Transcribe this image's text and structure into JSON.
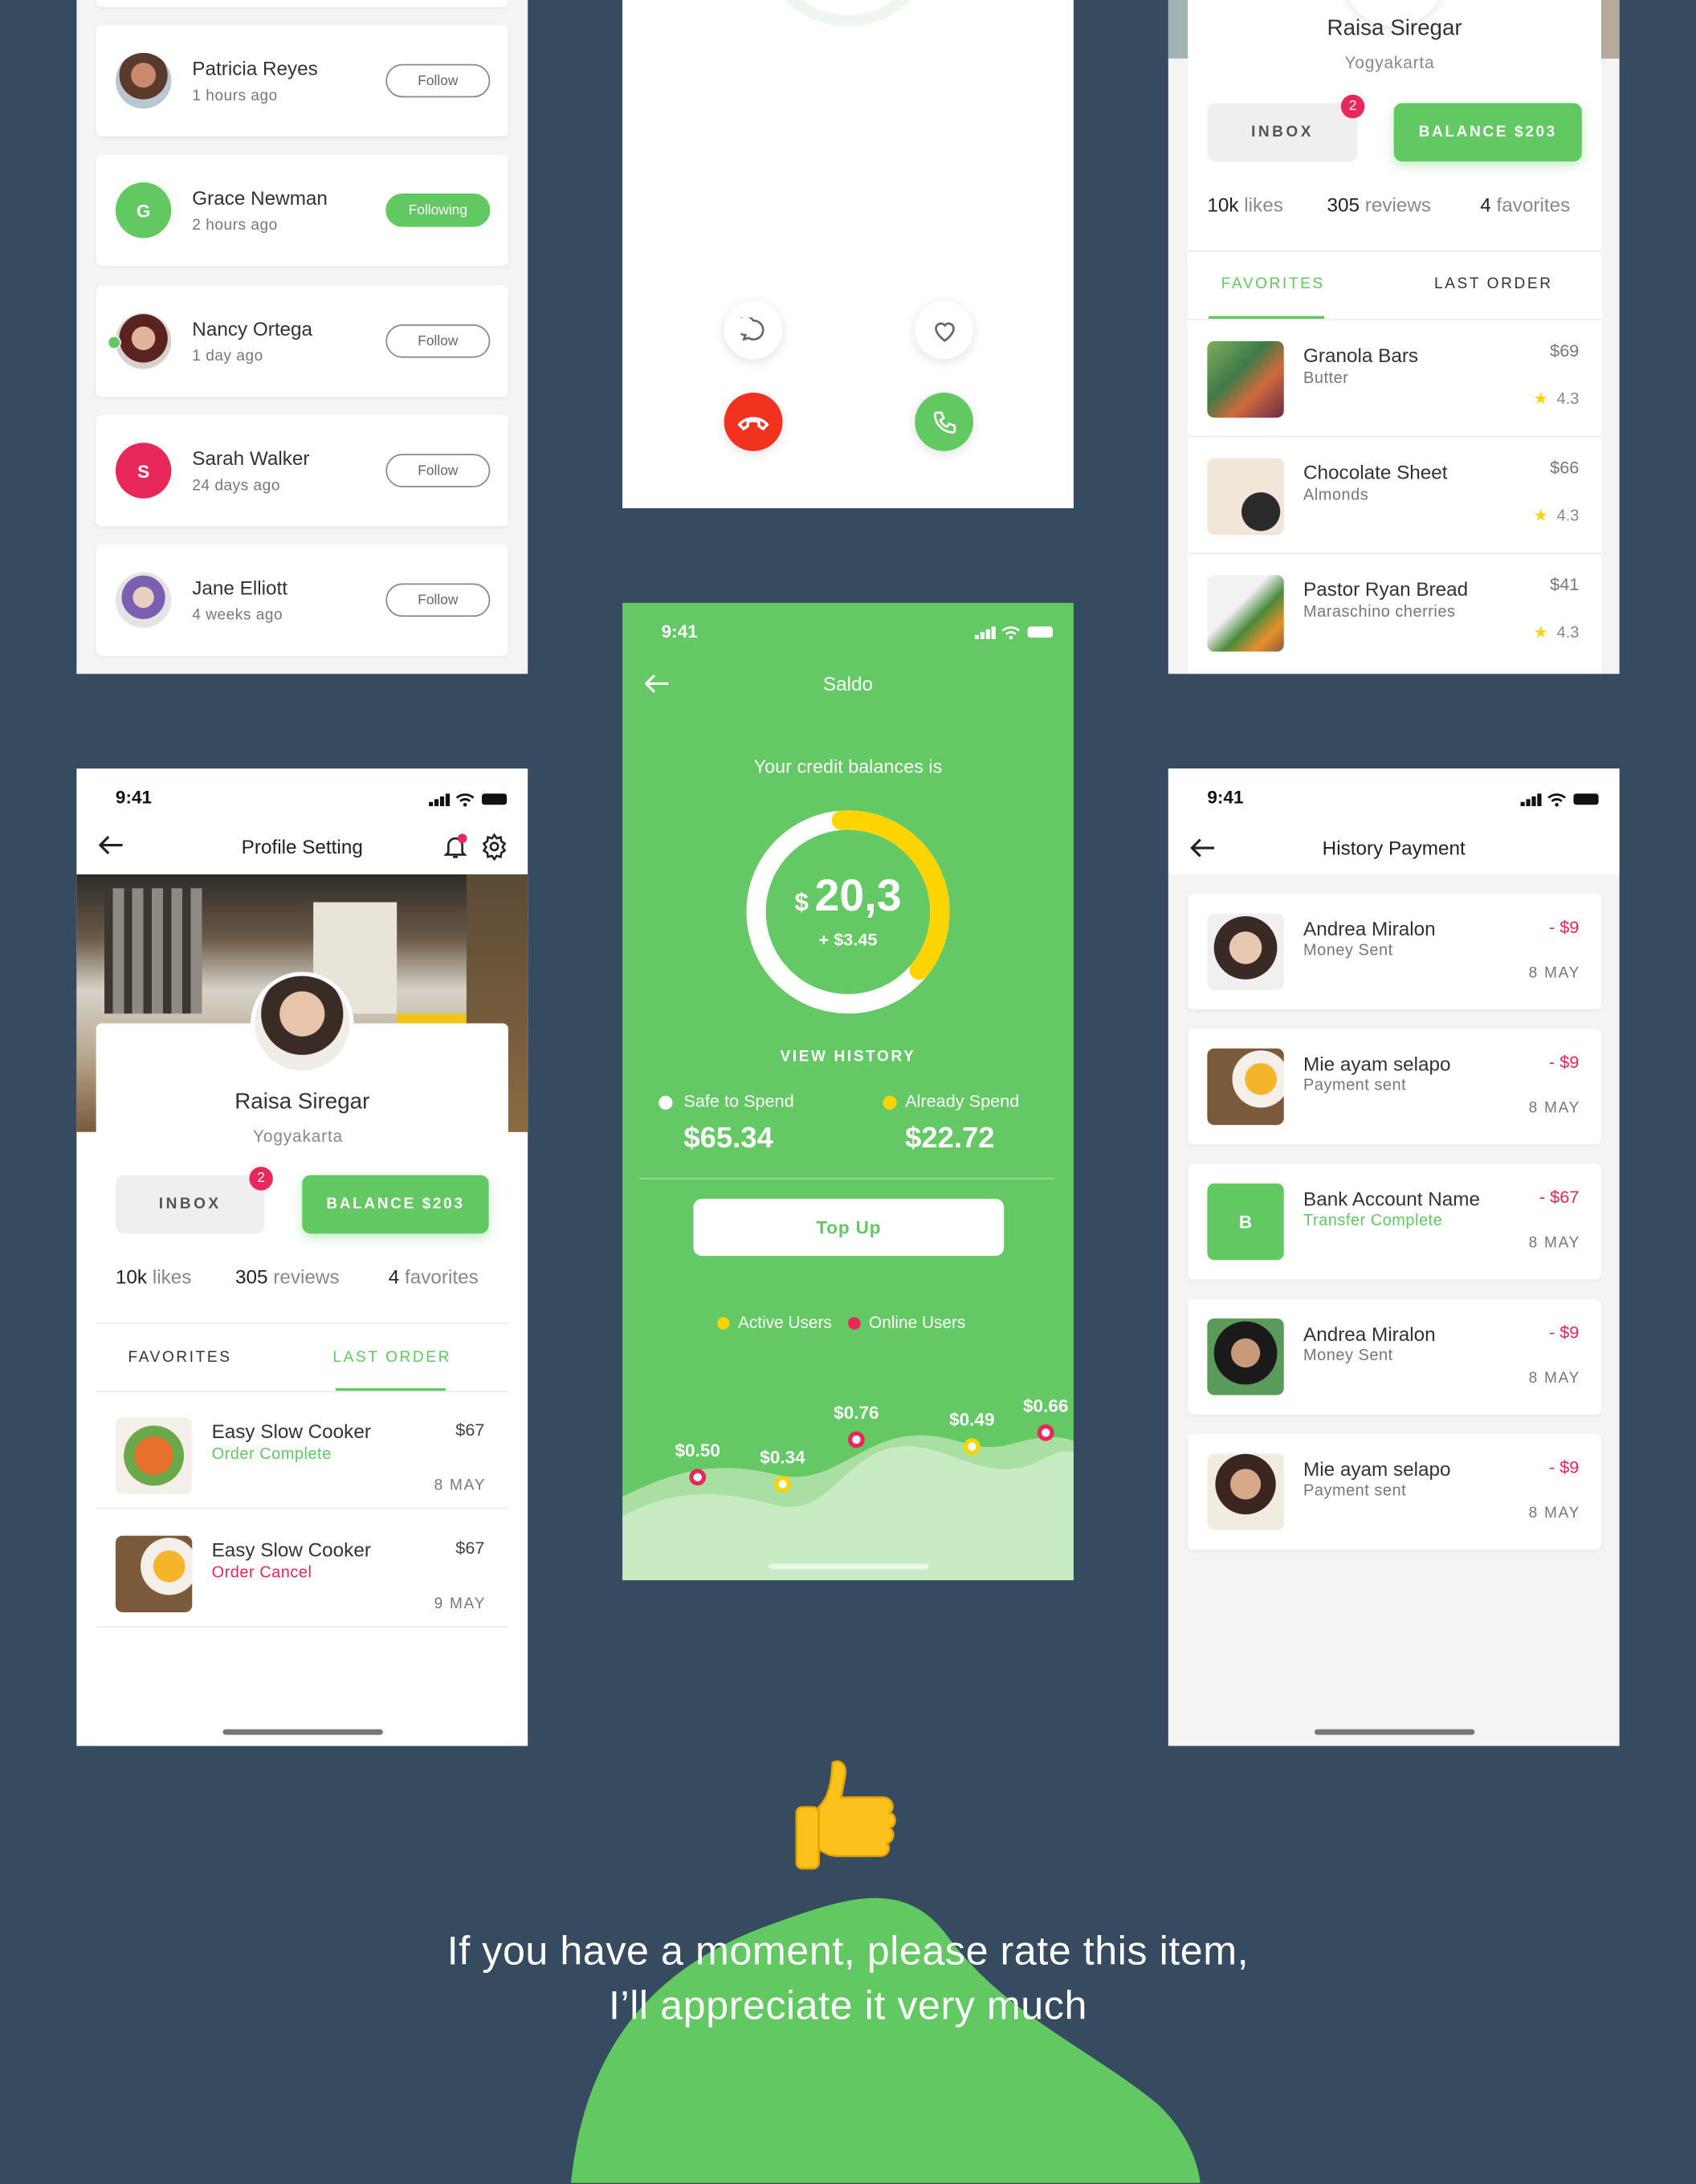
{
  "colors": {
    "background": "#374b60",
    "accent": "#62c862",
    "danger": "#e8285a",
    "yellow": "#ffd400",
    "call_red": "#f0321e"
  },
  "follow_list": {
    "items": [
      {
        "name": "Patricia Reyes",
        "time": "1 hours ago",
        "button": "Follow",
        "following": false,
        "avatar": "photo"
      },
      {
        "name": "Grace Newman",
        "time": "2 hours ago",
        "button": "Following",
        "following": true,
        "avatar": "G"
      },
      {
        "name": "Nancy Ortega",
        "time": "1 day ago",
        "button": "Follow",
        "following": false,
        "avatar": "photo",
        "online": true
      },
      {
        "name": "Sarah Walker",
        "time": "24 days ago",
        "button": "Follow",
        "following": false,
        "avatar": "S"
      },
      {
        "name": "Jane Elliott",
        "time": "4 weeks ago",
        "button": "Follow",
        "following": false,
        "avatar": "photo"
      }
    ]
  },
  "call": {
    "icons": [
      "chat-icon",
      "heart-icon",
      "hang-up-icon",
      "phone-icon"
    ]
  },
  "profile_favorites": {
    "name": "Raisa Siregar",
    "city": "Yogyakarta",
    "inbox": "INBOX",
    "inbox_badge": "2",
    "balance": "BALANCE $203",
    "stats": [
      {
        "n": "10k",
        "l": "likes"
      },
      {
        "n": "305",
        "l": "reviews"
      },
      {
        "n": "4",
        "l": "favorites"
      }
    ],
    "tabs": [
      "FAVORITES",
      "LAST ORDER"
    ],
    "active_tab": "FAVORITES",
    "items": [
      {
        "title": "Granola Bars",
        "sub": "Butter",
        "price": "$69",
        "rating": "4.3"
      },
      {
        "title": "Chocolate Sheet",
        "sub": "Almonds",
        "price": "$66",
        "rating": "4.3"
      },
      {
        "title": "Pastor Ryan Bread",
        "sub": "Maraschino cherries",
        "price": "$41",
        "rating": "4.3"
      }
    ]
  },
  "profile_setting": {
    "time": "9:41",
    "title": "Profile Setting",
    "name": "Raisa Siregar",
    "city": "Yogyakarta",
    "inbox": "INBOX",
    "inbox_badge": "2",
    "balance": "BALANCE $203",
    "stats": [
      {
        "n": "10k",
        "l": "likes"
      },
      {
        "n": "305",
        "l": "reviews"
      },
      {
        "n": "4",
        "l": "favorites"
      }
    ],
    "tabs": [
      "FAVORITES",
      "LAST ORDER"
    ],
    "active_tab": "LAST ORDER",
    "orders": [
      {
        "title": "Easy Slow Cooker",
        "status": "Order Complete",
        "status_color": "#62c862",
        "price": "$67",
        "date": "8 MAY"
      },
      {
        "title": "Easy Slow Cooker",
        "status": "Order Cancel",
        "status_color": "#e8285a",
        "price": "$67",
        "date": "9 MAY"
      }
    ]
  },
  "saldo": {
    "time": "9:41",
    "title": "Saldo",
    "subtitle": "Your credit balances is",
    "currency": "$",
    "amount": "20,3",
    "change": "+ $3.45",
    "spent_fraction": 0.37,
    "view_history": "VIEW HISTORY",
    "safe_label": "Safe to Spend",
    "safe_value": "$65.34",
    "spent_label": "Already Spend",
    "spent_value": "$22.72",
    "top_up": "Top Up",
    "legend": [
      "Active Users",
      "Online Users"
    ],
    "points": [
      {
        "label": "$0.50",
        "series": "Online Users"
      },
      {
        "label": "$0.34",
        "series": "Active Users"
      },
      {
        "label": "$0.76",
        "series": "Online Users"
      },
      {
        "label": "$0.49",
        "series": "Active Users"
      },
      {
        "label": "$0.66",
        "series": "Online Users"
      }
    ]
  },
  "history": {
    "time": "9:41",
    "title": "History Payment",
    "items": [
      {
        "name": "Andrea Miralon",
        "sub": "Money Sent",
        "amount": "- $9",
        "date": "8 MAY",
        "avatar": "photo"
      },
      {
        "name": "Mie ayam selapo",
        "sub": "Payment sent",
        "amount": "- $9",
        "date": "8 MAY",
        "avatar": "photo"
      },
      {
        "name": "Bank Account Name",
        "sub": "Transfer Complete",
        "amount": "- $67",
        "date": "8 MAY",
        "avatar": "B",
        "sub_green": true
      },
      {
        "name": "Andrea Miralon",
        "sub": "Money Sent",
        "amount": "- $9",
        "date": "8 MAY",
        "avatar": "photo"
      },
      {
        "name": "Mie ayam selapo",
        "sub": "Payment sent",
        "amount": "- $9",
        "date": "8 MAY",
        "avatar": "photo"
      }
    ]
  },
  "footer": {
    "line1": "If you have a moment, please rate this item,",
    "line2": "I’ll appreciate it very much",
    "icon": "thumbs-up-icon"
  }
}
